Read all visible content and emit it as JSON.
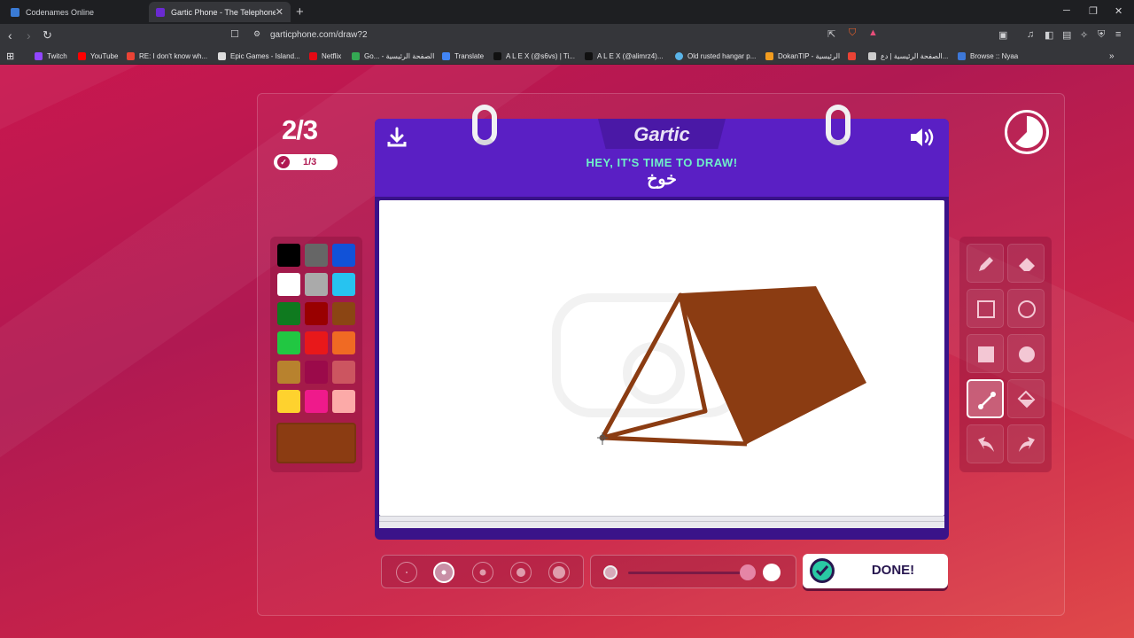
{
  "browser": {
    "tabs": [
      {
        "title": "Codenames Online",
        "active": false
      },
      {
        "title": "Gartic Phone - The Telephone G...",
        "active": true
      }
    ],
    "url": "garticphone.com/draw?2",
    "bookmarks": [
      "Twitch",
      "YouTube",
      "RE: I don't know wh...",
      "Epic Games - Island...",
      "Netflix",
      "Go... - الصفحة الرئيسية",
      "Translate",
      "A L E X (@s6vs) | Ti...",
      "A L E X (@alimrz4)...",
      "Old rusted hangar p...",
      "DokanTIP - الرئيسية",
      "الصفحة الرئيسية | دع...",
      "Browse :: Nyaa"
    ]
  },
  "game": {
    "round": "2/3",
    "players_done": "1/3",
    "logo": "Gartic",
    "headline": "HEY, IT'S TIME TO DRAW!",
    "prompt_word": "خوخ",
    "done_label": "DONE!",
    "selected_color": "#8b3c12",
    "active_tool": "line",
    "brush_size_index": 1,
    "opacity": 0.9
  },
  "palette": {
    "colors": [
      "#000000",
      "#666666",
      "#1152d8",
      "#ffffff",
      "#aaaaaa",
      "#27c3f0",
      "#0f7a1f",
      "#990000",
      "#8b4513",
      "#21c742",
      "#e8181a",
      "#f06a23",
      "#b8822e",
      "#9b0a4a",
      "#cc5560",
      "#fed22e",
      "#ef1a8b",
      "#fcaaa8"
    ]
  },
  "tools": [
    "pencil",
    "eraser",
    "rectangle-outline",
    "ellipse-outline",
    "rectangle-filled",
    "ellipse-filled",
    "line",
    "fill-bucket",
    "undo",
    "redo"
  ]
}
